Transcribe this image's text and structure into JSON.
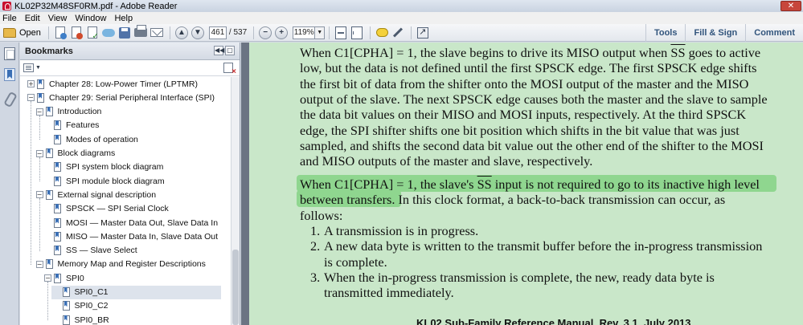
{
  "window": {
    "title": "KL02P32M48SF0RM.pdf - Adobe Reader",
    "close_label": "✕"
  },
  "menu": [
    "File",
    "Edit",
    "View",
    "Window",
    "Help"
  ],
  "toolbar": {
    "open_label": "Open",
    "page_current": "461",
    "page_total": "/ 537",
    "zoom": "119%",
    "right_buttons": [
      "Tools",
      "Fill & Sign",
      "Comment"
    ]
  },
  "icons": {
    "rail": [
      "pages-icon",
      "bookmark-icon",
      "attachment-icon"
    ],
    "toolbar": [
      "folder-icon",
      "create-pdf-icon",
      "export-pdf-icon",
      "sign-icon",
      "cloud-upload-icon",
      "save-icon",
      "print-icon",
      "email-icon",
      "previous-page-icon",
      "next-page-icon",
      "zoom-out-icon",
      "zoom-in-icon",
      "fit-page-icon",
      "fit-width-icon",
      "comment-icon",
      "highlight-pen-icon",
      "full-screen-icon"
    ]
  },
  "bookmarks": {
    "title": "Bookmarks",
    "items": [
      {
        "label": "Chapter 28: Low-Power Timer (LPTMR)",
        "toggle": "+"
      },
      {
        "label": "Chapter 29: Serial Peripheral Interface (SPI)",
        "toggle": "−"
      },
      {
        "label": "Introduction",
        "toggle": "−"
      },
      {
        "label": "Features",
        "toggle": ""
      },
      {
        "label": "Modes of operation",
        "toggle": ""
      },
      {
        "label": "Block diagrams",
        "toggle": "−"
      },
      {
        "label": "SPI system block diagram",
        "toggle": ""
      },
      {
        "label": "SPI module block diagram",
        "toggle": ""
      },
      {
        "label": "External signal description",
        "toggle": "−"
      },
      {
        "label": "SPSCK — SPI Serial Clock",
        "toggle": ""
      },
      {
        "label": "MOSI — Master Data Out, Slave Data In",
        "toggle": ""
      },
      {
        "label": "MISO — Master Data In, Slave Data Out",
        "toggle": ""
      },
      {
        "label": "SS — Slave Select",
        "toggle": ""
      },
      {
        "label": "Memory Map and Register Descriptions",
        "toggle": "−"
      },
      {
        "label": "SPI0",
        "toggle": "−"
      },
      {
        "label": "SPI0_C1",
        "toggle": ""
      },
      {
        "label": "SPI0_C2",
        "toggle": ""
      },
      {
        "label": "SPI0_BR",
        "toggle": ""
      }
    ]
  },
  "document": {
    "para1": [
      "When C1[CPHA] = 1, the slave begins to drive its MISO output when SS goes to active",
      "low, but the data is not defined until the first SPSCK edge. The first SPSCK edge shifts",
      "the first bit of data from the shifter onto the MOSI output of the master and the MISO",
      "output of the slave. The next SPSCK edge causes both the master and the slave to sample",
      "the data bit values on their MISO and MOSI inputs, respectively. At the third SPSCK",
      "edge, the SPI shifter shifts one bit position which shifts in the bit value that was just",
      "sampled, and shifts the second data bit value out the other end of the shifter to the MOSI",
      "and MISO outputs of the master and slave, respectively."
    ],
    "para2": [
      "When C1[CPHA] = 1, the slave's SS input is not required to go to its inactive high level",
      "between transfers. In this clock format, a back-to-back transmission can occur, as",
      "follows:"
    ],
    "list": [
      {
        "num": "1.",
        "lines": [
          "A transmission is in progress."
        ]
      },
      {
        "num": "2.",
        "lines": [
          "A new data byte is written to the transmit buffer before the in-progress transmission",
          "is complete."
        ]
      },
      {
        "num": "3.",
        "lines": [
          "When the in-progress transmission is complete, the new, ready data byte is",
          "transmitted immediately."
        ]
      }
    ],
    "footer": "KL02 Sub-Family Reference Manual, Rev. 3.1, July 2013"
  }
}
